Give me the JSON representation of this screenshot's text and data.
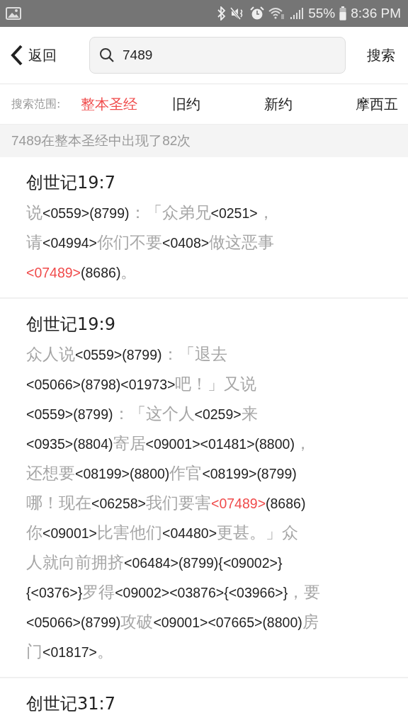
{
  "status_bar": {
    "battery_text": "55%",
    "time": "8:36 PM"
  },
  "header": {
    "back_label": "返回",
    "search": {
      "value": "7489"
    },
    "search_button": "搜索"
  },
  "scope": {
    "label": "搜索范围:",
    "tabs": [
      {
        "label": "整本圣经",
        "selected": true
      },
      {
        "label": "旧约",
        "selected": false
      },
      {
        "label": "新约",
        "selected": false
      },
      {
        "label": "摩西五",
        "selected": false
      }
    ]
  },
  "result_count": "7489在整本圣经中出现了82次",
  "results": [
    {
      "reference": "创世记19:7",
      "lines": [
        [
          {
            "kind": "word",
            "text": "说"
          },
          {
            "kind": "code",
            "text": "<0559>(8799)"
          },
          {
            "kind": "word",
            "text": "：「众弟兄"
          },
          {
            "kind": "code",
            "text": "<0251>"
          },
          {
            "kind": "word",
            "text": "，"
          }
        ],
        [
          {
            "kind": "word",
            "text": "请"
          },
          {
            "kind": "code",
            "text": "<04994>"
          },
          {
            "kind": "word",
            "text": "你们不要"
          },
          {
            "kind": "code",
            "text": "<0408>"
          },
          {
            "kind": "word",
            "text": "做这恶事"
          }
        ],
        [
          {
            "kind": "hit",
            "text": "<07489>"
          },
          {
            "kind": "code",
            "text": "(8686)"
          },
          {
            "kind": "word",
            "text": "。"
          }
        ]
      ]
    },
    {
      "reference": "创世记19:9",
      "lines": [
        [
          {
            "kind": "word",
            "text": "众人说"
          },
          {
            "kind": "code",
            "text": "<0559>(8799)"
          },
          {
            "kind": "word",
            "text": "：「退去"
          }
        ],
        [
          {
            "kind": "code",
            "text": "<05066>(8798)<01973>"
          },
          {
            "kind": "word",
            "text": "吧！」又说"
          }
        ],
        [
          {
            "kind": "code",
            "text": "<0559>(8799)"
          },
          {
            "kind": "word",
            "text": "：「这个人"
          },
          {
            "kind": "code",
            "text": "<0259>"
          },
          {
            "kind": "word",
            "text": "来"
          }
        ],
        [
          {
            "kind": "code",
            "text": "<0935>(8804)"
          },
          {
            "kind": "word",
            "text": "寄居"
          },
          {
            "kind": "code",
            "text": "<09001><01481>(8800)"
          },
          {
            "kind": "word",
            "text": "，"
          }
        ],
        [
          {
            "kind": "word",
            "text": "还想要"
          },
          {
            "kind": "code",
            "text": "<08199>(8800)"
          },
          {
            "kind": "word",
            "text": "作官"
          },
          {
            "kind": "code",
            "text": "<08199>(8799)"
          }
        ],
        [
          {
            "kind": "word",
            "text": "哪！现在"
          },
          {
            "kind": "code",
            "text": "<06258>"
          },
          {
            "kind": "word",
            "text": "我们要害"
          },
          {
            "kind": "hit",
            "text": "<07489>"
          },
          {
            "kind": "code",
            "text": "(8686)"
          }
        ],
        [
          {
            "kind": "word",
            "text": "你"
          },
          {
            "kind": "code",
            "text": "<09001>"
          },
          {
            "kind": "word",
            "text": "比害他们"
          },
          {
            "kind": "code",
            "text": "<04480>"
          },
          {
            "kind": "word",
            "text": "更甚。」众"
          }
        ],
        [
          {
            "kind": "word",
            "text": "人就向前拥挤"
          },
          {
            "kind": "code",
            "text": "<06484>(8799){<09002>}"
          }
        ],
        [
          {
            "kind": "code",
            "text": "{<0376>}"
          },
          {
            "kind": "word",
            "text": "罗得"
          },
          {
            "kind": "code",
            "text": "<09002><03876>{<03966>}"
          },
          {
            "kind": "word",
            "text": "，要"
          }
        ],
        [
          {
            "kind": "code",
            "text": "<05066>(8799)"
          },
          {
            "kind": "word",
            "text": "攻破"
          },
          {
            "kind": "code",
            "text": "<09001><07665>(8800)"
          },
          {
            "kind": "word",
            "text": "房"
          }
        ],
        [
          {
            "kind": "word",
            "text": "门"
          },
          {
            "kind": "code",
            "text": "<01817>"
          },
          {
            "kind": "word",
            "text": "。"
          }
        ]
      ]
    },
    {
      "reference": "创世记31:7"
    }
  ]
}
